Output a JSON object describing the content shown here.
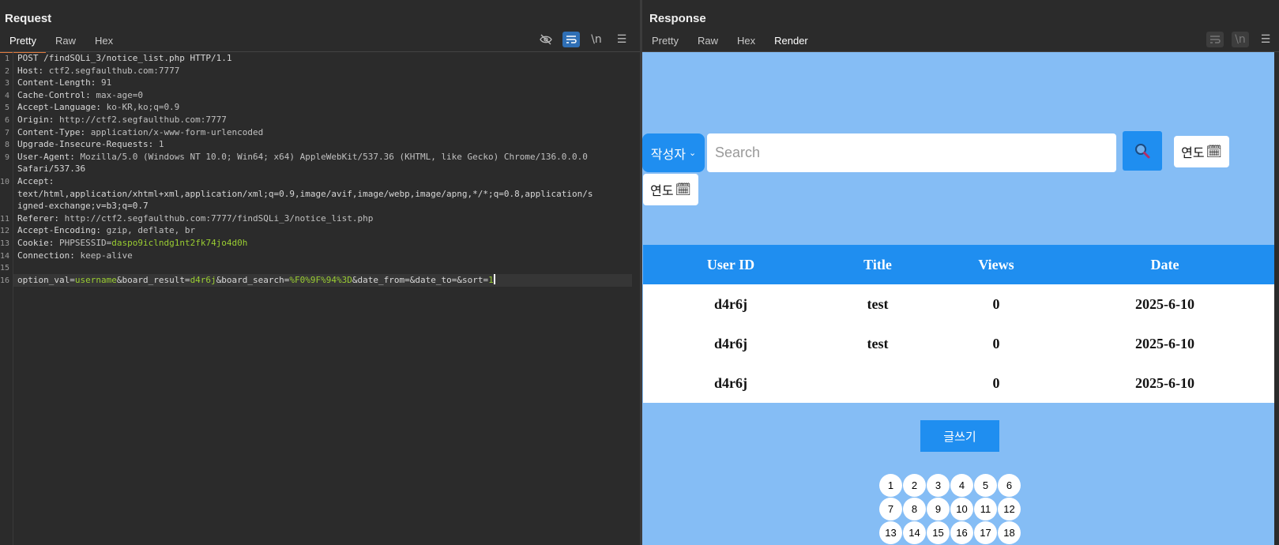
{
  "request": {
    "title": "Request",
    "tabs": [
      "Pretty",
      "Raw",
      "Hex"
    ],
    "active_tab": "Pretty",
    "tool_icons": [
      "eye-off-icon",
      "wrap-lines-icon",
      "newline-icon",
      "menu-icon"
    ],
    "newline_label": "\\n",
    "lines": [
      {
        "n": "1",
        "text": "POST /findSQLi_3/notice_list.php HTTP/1.1"
      },
      {
        "n": "2",
        "key": "Host",
        "val": " ctf2.segfaulthub.com:7777"
      },
      {
        "n": "3",
        "key": "Content-Length",
        "val": " 91"
      },
      {
        "n": "4",
        "key": "Cache-Control",
        "val": " max-age=0"
      },
      {
        "n": "5",
        "key": "Accept-Language",
        "val": " ko-KR,ko;q=0.9"
      },
      {
        "n": "6",
        "key": "Origin",
        "val": " http://ctf2.segfaulthub.com:7777"
      },
      {
        "n": "7",
        "key": "Content-Type",
        "val": " application/x-www-form-urlencoded"
      },
      {
        "n": "8",
        "key": "Upgrade-Insecure-Requests",
        "val": " 1"
      },
      {
        "n": "9",
        "key": "User-Agent",
        "val": " Mozilla/5.0 (Windows NT 10.0; Win64; x64) AppleWebKit/537.36 (KHTML, like Gecko) Chrome/136.0.0.0"
      },
      {
        "n": "",
        "text": "Safari/537.36"
      },
      {
        "n": "10",
        "key": "Accept",
        "val": ""
      },
      {
        "n": "",
        "text": "text/html,application/xhtml+xml,application/xml;q=0.9,image/avif,image/webp,image/apng,*/*;q=0.8,application/s"
      },
      {
        "n": "",
        "text": "igned-exchange;v=b3;q=0.7"
      },
      {
        "n": "11",
        "key": "Referer",
        "val": " http://ctf2.segfaulthub.com:7777/findSQLi_3/notice_list.php"
      },
      {
        "n": "12",
        "key": "Accept-Encoding",
        "val": " gzip, deflate, br"
      },
      {
        "n": "13",
        "key": "Cookie",
        "val": " PHPSESSID=",
        "green": "daspo9iclndg1nt2fk74jo4d0h"
      },
      {
        "n": "14",
        "key": "Connection",
        "val": " keep-alive"
      },
      {
        "n": "15",
        "text": ""
      }
    ],
    "body_line": {
      "n": "16",
      "parts": [
        {
          "t": "option_val=",
          "g": false
        },
        {
          "t": "username",
          "g": true
        },
        {
          "t": "&board_result=",
          "g": false
        },
        {
          "t": "d4r6j",
          "g": true
        },
        {
          "t": "&board_search=",
          "g": false
        },
        {
          "t": "%F0%9F%94%3D",
          "g": true
        },
        {
          "t": "&date_from=&date_to=&sort=",
          "g": false
        },
        {
          "t": "1",
          "g": true
        }
      ]
    }
  },
  "response": {
    "title": "Response",
    "tabs": [
      "Pretty",
      "Raw",
      "Hex",
      "Render"
    ],
    "active_tab": "Render",
    "tool_icons": [
      "wrap-lines-icon",
      "newline-icon",
      "menu-icon"
    ],
    "newline_label": "\\n",
    "render": {
      "select_label": "작성자",
      "search_placeholder": "Search",
      "date_label": "연도",
      "columns": [
        "User ID",
        "Title",
        "Views",
        "Date"
      ],
      "rows": [
        [
          "d4r6j",
          "test",
          "0",
          "2025-6-10"
        ],
        [
          "d4r6j",
          "test",
          "0",
          "2025-6-10"
        ],
        [
          "d4r6j",
          "",
          "0",
          "2025-6-10"
        ]
      ],
      "write_button": "글쓰기",
      "pages": [
        "1",
        "2",
        "3",
        "4",
        "5",
        "6",
        "7",
        "8",
        "9",
        "10",
        "11",
        "12",
        "13",
        "14",
        "15",
        "16",
        "17",
        "18"
      ]
    }
  },
  "colors": {
    "accent_tab": "#e07a3c",
    "render_bg": "#85bdf5",
    "table_header": "#1f8ef0",
    "value_green": "#9acd32"
  }
}
